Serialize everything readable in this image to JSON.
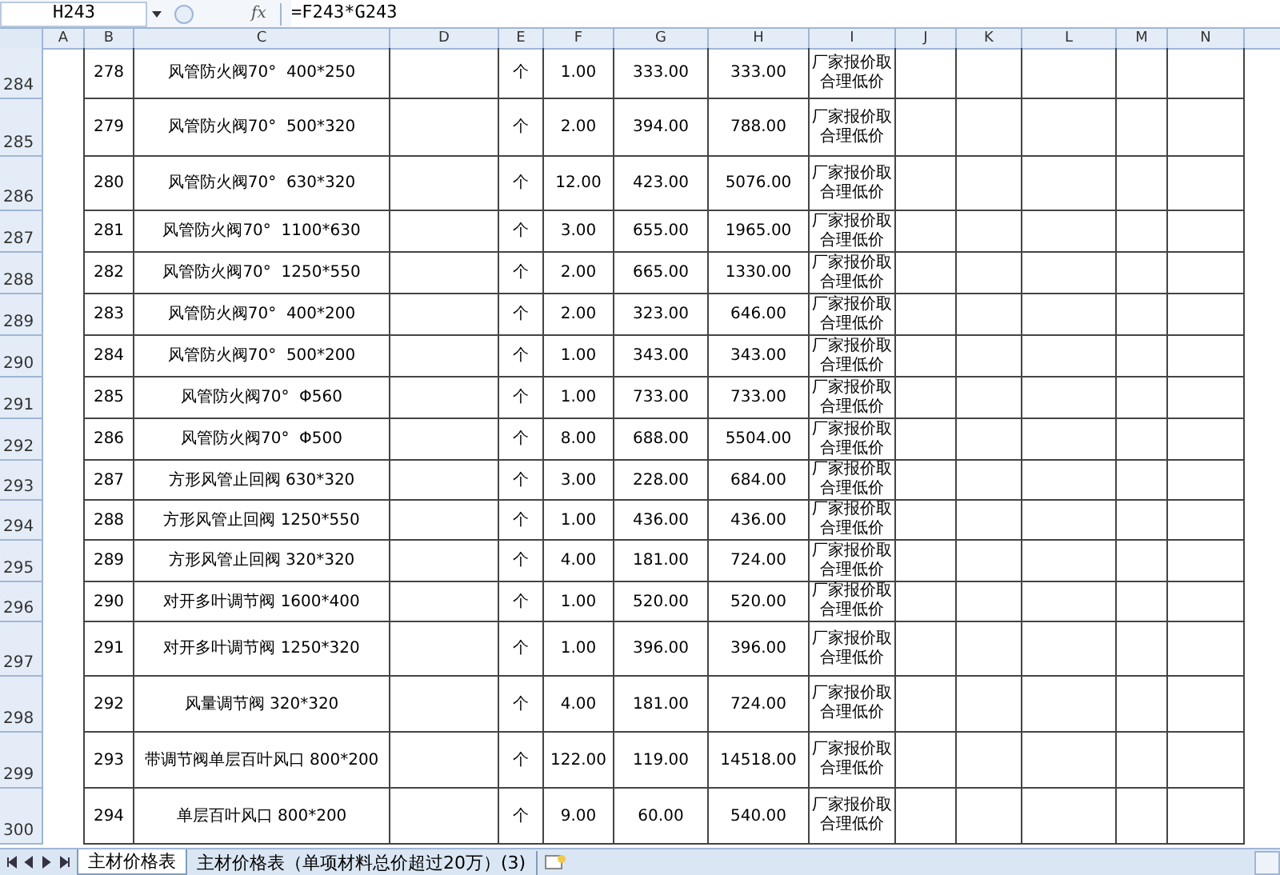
{
  "formula_bar": {
    "name_box": "H243",
    "fx_label": "fx",
    "formula": "=F243*G243"
  },
  "columns": [
    "A",
    "B",
    "C",
    "D",
    "E",
    "F",
    "G",
    "H",
    "I",
    "J",
    "K",
    "L",
    "M",
    "N"
  ],
  "rows": [
    {
      "row": "284",
      "cells": [
        "",
        "278",
        "风管防火阀70°  400*250",
        "",
        "个",
        "1.00",
        "333.00",
        "333.00",
        "厂家报价取合理低价"
      ]
    },
    {
      "row": "285",
      "cells": [
        "",
        "279",
        "风管防火阀70°  500*320",
        "",
        "个",
        "2.00",
        "394.00",
        "788.00",
        "厂家报价取合理低价"
      ]
    },
    {
      "row": "286",
      "cells": [
        "",
        "280",
        "风管防火阀70°  630*320",
        "",
        "个",
        "12.00",
        "423.00",
        "5076.00",
        "厂家报价取合理低价"
      ]
    },
    {
      "row": "287",
      "cells": [
        "",
        "281",
        "风管防火阀70°  1100*630",
        "",
        "个",
        "3.00",
        "655.00",
        "1965.00",
        "厂家报价取合理低价"
      ]
    },
    {
      "row": "288",
      "cells": [
        "",
        "282",
        "风管防火阀70°  1250*550",
        "",
        "个",
        "2.00",
        "665.00",
        "1330.00",
        "厂家报价取合理低价"
      ]
    },
    {
      "row": "289",
      "cells": [
        "",
        "283",
        "风管防火阀70°  400*200",
        "",
        "个",
        "2.00",
        "323.00",
        "646.00",
        "厂家报价取合理低价"
      ]
    },
    {
      "row": "290",
      "cells": [
        "",
        "284",
        "风管防火阀70°  500*200",
        "",
        "个",
        "1.00",
        "343.00",
        "343.00",
        "厂家报价取合理低价"
      ]
    },
    {
      "row": "291",
      "cells": [
        "",
        "285",
        "风管防火阀70°  Φ560",
        "",
        "个",
        "1.00",
        "733.00",
        "733.00",
        "厂家报价取合理低价"
      ]
    },
    {
      "row": "292",
      "cells": [
        "",
        "286",
        "风管防火阀70°  Φ500",
        "",
        "个",
        "8.00",
        "688.00",
        "5504.00",
        "厂家报价取合理低价"
      ]
    },
    {
      "row": "293",
      "cells": [
        "",
        "287",
        "方形风管止回阀 630*320",
        "",
        "个",
        "3.00",
        "228.00",
        "684.00",
        "厂家报价取合理低价"
      ]
    },
    {
      "row": "294",
      "cells": [
        "",
        "288",
        "方形风管止回阀 1250*550",
        "",
        "个",
        "1.00",
        "436.00",
        "436.00",
        "厂家报价取合理低价"
      ]
    },
    {
      "row": "295",
      "cells": [
        "",
        "289",
        "方形风管止回阀 320*320",
        "",
        "个",
        "4.00",
        "181.00",
        "724.00",
        "厂家报价取合理低价"
      ]
    },
    {
      "row": "296",
      "cells": [
        "",
        "290",
        "对开多叶调节阀 1600*400",
        "",
        "个",
        "1.00",
        "520.00",
        "520.00",
        "厂家报价取合理低价"
      ]
    },
    {
      "row": "297",
      "cells": [
        "",
        "291",
        "对开多叶调节阀 1250*320",
        "",
        "个",
        "1.00",
        "396.00",
        "396.00",
        "厂家报价取合理低价"
      ]
    },
    {
      "row": "298",
      "cells": [
        "",
        "292",
        "风量调节阀 320*320",
        "",
        "个",
        "4.00",
        "181.00",
        "724.00",
        "厂家报价取合理低价"
      ]
    },
    {
      "row": "299",
      "cells": [
        "",
        "293",
        "带调节阀单层百叶风口 800*200",
        "",
        "个",
        "122.00",
        "119.00",
        "14518.00",
        "厂家报价取合理低价"
      ]
    },
    {
      "row": "300",
      "cells": [
        "",
        "294",
        "单层百叶风口 800*200",
        "",
        "个",
        "9.00",
        "60.00",
        "540.00",
        "厂家报价取合理低价"
      ]
    }
  ],
  "sheet_tabs": [
    {
      "label": "主材价格表",
      "selected": true
    },
    {
      "label": "主材价格表（单项材料总价超过20万）(3)",
      "selected": false
    }
  ]
}
